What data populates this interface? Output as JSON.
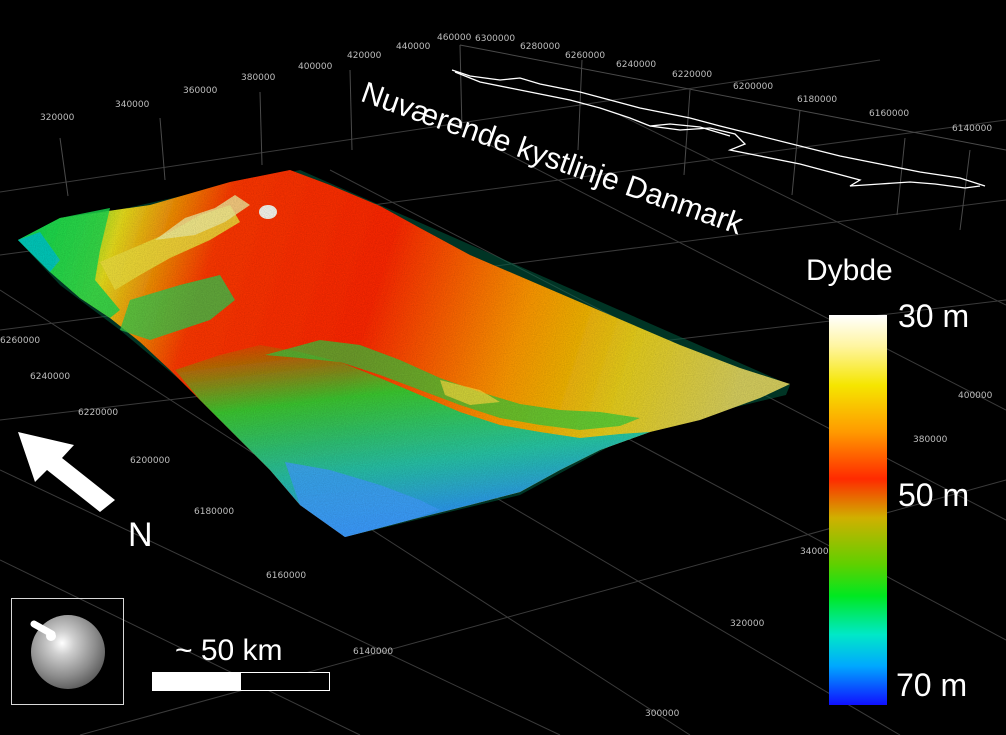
{
  "map": {
    "coastline_label": "Nuværende kystlinje Danmark",
    "north_label": "N",
    "legend": {
      "title": "Dybde",
      "labels": [
        "30 m",
        "50 m",
        "70 m"
      ]
    },
    "scale": {
      "label": "~ 50 km"
    },
    "axis_ticks_top_x": [
      "320000",
      "340000",
      "360000",
      "380000",
      "400000",
      "420000",
      "440000",
      "460000"
    ],
    "axis_ticks_top_y": [
      "6300000",
      "6280000",
      "6260000",
      "6240000",
      "6220000",
      "6200000",
      "6180000",
      "6160000",
      "6140000"
    ],
    "axis_ticks_left_y": [
      "6260000",
      "6240000",
      "6220000",
      "6200000",
      "6180000",
      "6160000",
      "6140000"
    ],
    "axis_ticks_right_x": [
      "400000",
      "380000",
      "340000",
      "320000",
      "300000"
    ],
    "colors": {
      "shallow": "#ffffff",
      "mid": "#ff2a00",
      "deep": "#1010ff",
      "background": "#000000"
    }
  }
}
